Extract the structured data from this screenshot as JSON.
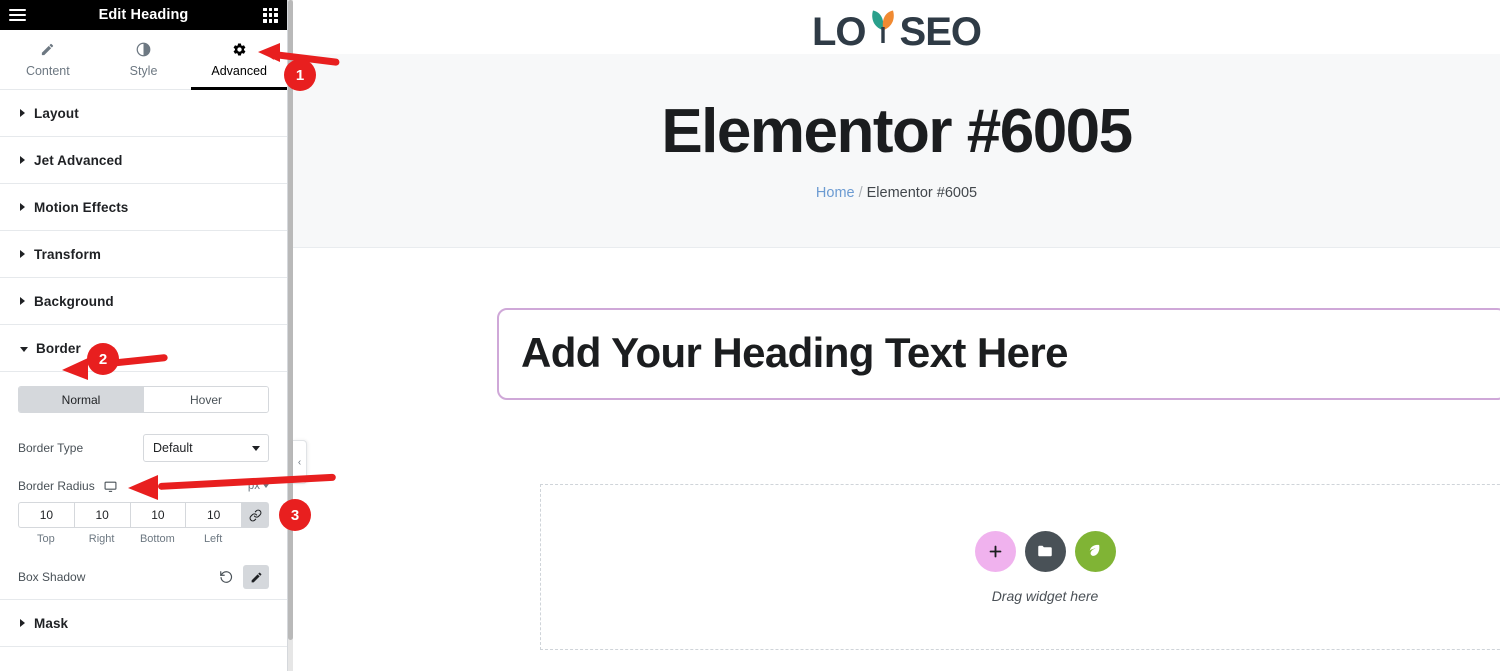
{
  "panel": {
    "header": {
      "title": "Edit Heading",
      "menu_icon": "hamburger-icon",
      "apps_icon": "grid-icon"
    },
    "tabs": [
      {
        "label": "Content",
        "icon": "pencil-icon",
        "active": false
      },
      {
        "label": "Style",
        "icon": "half-circle-icon",
        "active": false
      },
      {
        "label": "Advanced",
        "icon": "gear-icon",
        "active": true
      }
    ],
    "sections": [
      {
        "label": "Layout",
        "open": false
      },
      {
        "label": "Jet Advanced",
        "open": false
      },
      {
        "label": "Motion Effects",
        "open": false
      },
      {
        "label": "Transform",
        "open": false
      },
      {
        "label": "Background",
        "open": false
      },
      {
        "label": "Border",
        "open": true
      },
      {
        "label": "Mask",
        "open": false
      }
    ],
    "border_section": {
      "states": [
        {
          "label": "Normal",
          "active": true
        },
        {
          "label": "Hover",
          "active": false
        }
      ],
      "border_type": {
        "label": "Border Type",
        "value": "Default"
      },
      "border_radius": {
        "label": "Border Radius",
        "device_icon": "monitor-icon",
        "unit": "px",
        "link_icon": "link-icon",
        "values": [
          {
            "value": "10",
            "sublabel": "Top"
          },
          {
            "value": "10",
            "sublabel": "Right"
          },
          {
            "value": "10",
            "sublabel": "Bottom"
          },
          {
            "value": "10",
            "sublabel": "Left"
          }
        ]
      },
      "box_shadow": {
        "label": "Box Shadow",
        "reset_icon": "reset-icon",
        "edit_icon": "pencil-icon"
      }
    }
  },
  "canvas": {
    "site_logo": {
      "text_before": "LO",
      "text_after": "SEO",
      "leaf_left_color": "#2aa08c",
      "leaf_right_color": "#f08a32",
      "text_color": "#2f3b46"
    },
    "hero": {
      "title": "Elementor #6005",
      "breadcrumb": {
        "home": "Home",
        "separator": "/",
        "current": "Elementor #6005"
      }
    },
    "heading_widget": {
      "text": "Add Your Heading Text Here",
      "selection_border_color": "#cfa8d8"
    },
    "dropzone": {
      "buttons": [
        {
          "name": "add-element-button",
          "icon": "plus-icon",
          "color": "#f0b2ee"
        },
        {
          "name": "add-template-button",
          "icon": "folder-icon",
          "color": "#495157"
        },
        {
          "name": "ai-button",
          "icon": "leaf-icon",
          "color": "#80b435"
        }
      ],
      "label": "Drag widget here"
    },
    "collapse_handle": {
      "icon": "chevron-left-icon"
    }
  },
  "annotations": {
    "color": "#e81f1f",
    "badges": [
      {
        "number": "1",
        "target": "advanced-tab"
      },
      {
        "number": "2",
        "target": "border-section"
      },
      {
        "number": "3",
        "target": "border-radius-control"
      }
    ]
  }
}
